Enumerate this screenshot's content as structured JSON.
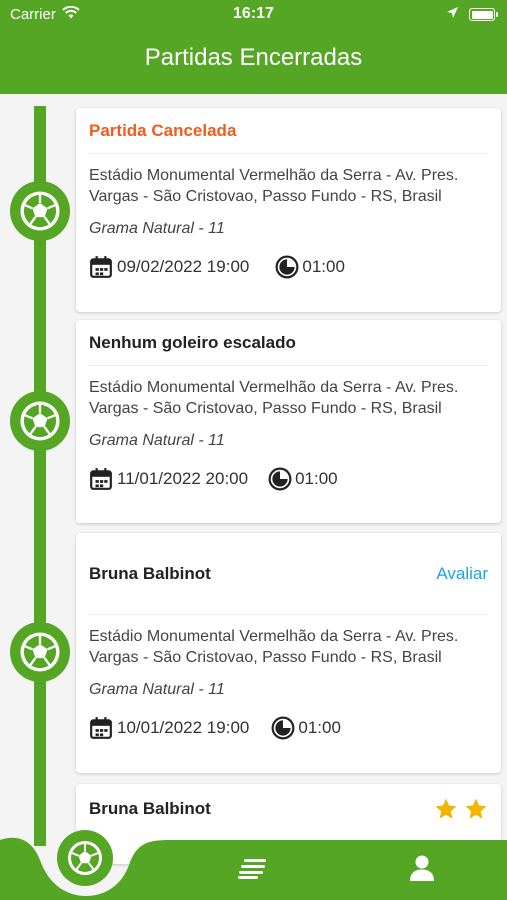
{
  "status": {
    "carrier": "Carrier",
    "time": "16:17"
  },
  "header": {
    "title": "Partidas Encerradas"
  },
  "matches": [
    {
      "title": "Partida Cancelada",
      "address": "Estádio Monumental Vermelhão da Serra - Av. Pres. Vargas - São Cristovao, Passo Fundo - RS, Brasil",
      "field": "Grama Natural - 11",
      "datetime": "09/02/2022 19:00",
      "duration": "01:00"
    },
    {
      "title": "Nenhum goleiro escalado",
      "address": "Estádio Monumental Vermelhão da Serra - Av. Pres. Vargas - São Cristovao, Passo Fundo - RS, Brasil",
      "field": "Grama Natural - 11",
      "datetime": "11/01/2022 20:00",
      "duration": "01:00"
    },
    {
      "title": "Bruna Balbinot",
      "action": "Avaliar",
      "address": "Estádio Monumental Vermelhão da Serra - Av. Pres. Vargas - São Cristovao, Passo Fundo - RS, Brasil",
      "field": "Grama Natural - 11",
      "datetime": "10/01/2022 19:00",
      "duration": "01:00"
    },
    {
      "title": "Bruna Balbinot",
      "rating": 2
    }
  ],
  "colors": {
    "brand": "#56a626",
    "cancel": "#f25a1e",
    "link": "#1aa5e2",
    "star": "#f5b400"
  },
  "icons": [
    "wifi-icon",
    "location-arrow-icon",
    "battery-icon",
    "soccer-ball-icon",
    "calendar-icon",
    "duration-icon",
    "star-icon",
    "list-icon",
    "profile-icon"
  ]
}
